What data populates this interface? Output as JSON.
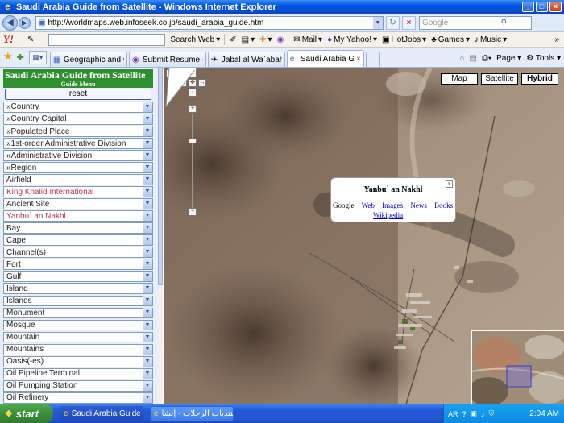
{
  "window": {
    "title": "Saudi Arabia Guide from Satellite - Windows Internet Explorer",
    "minimize": "_",
    "maximize": "□",
    "close": "×"
  },
  "address": {
    "url": "http://worldmaps.web.infoseek.co.jp/saudi_arabia_guide.htm",
    "search_placeholder": "Google"
  },
  "yahoo_toolbar": {
    "logo": "Y!",
    "search_button": "Search Web",
    "mail": "Mail",
    "my_yahoo": "My Yahoo!",
    "hotjobs": "HotJobs",
    "games": "Games",
    "music": "Music"
  },
  "tabs": [
    {
      "label": "Geographic and Geosp..."
    },
    {
      "label": "Submit Resume - Get N..."
    },
    {
      "label": "Jabal al Wa`abah, Sau..."
    },
    {
      "label": "Saudi Arabia Guide ..."
    }
  ],
  "tab_tools": {
    "page": "Page",
    "tools": "Tools"
  },
  "sidebar": {
    "title": "Saudi Arabia Guide from Satellite",
    "subtitle": "Guide Menu",
    "reset": "reset",
    "selects": [
      {
        "label": "»Country",
        "highlight": false
      },
      {
        "label": "»Country Capital",
        "highlight": false
      },
      {
        "label": "»Populated Place",
        "highlight": false
      },
      {
        "label": "»1st-order Administrative Division",
        "highlight": false
      },
      {
        "label": "»Administrative Division",
        "highlight": false
      },
      {
        "label": "»Region",
        "highlight": false
      },
      {
        "label": "Airfield",
        "highlight": false
      },
      {
        "label": "King Khalid International",
        "highlight": true
      },
      {
        "label": "Ancient Site",
        "highlight": false
      },
      {
        "label": "Yanbu` an Nakhl",
        "highlight": true
      },
      {
        "label": "Bay",
        "highlight": false
      },
      {
        "label": "Cape",
        "highlight": false
      },
      {
        "label": "Channel(s)",
        "highlight": false
      },
      {
        "label": "Fort",
        "highlight": false
      },
      {
        "label": "Gulf",
        "highlight": false
      },
      {
        "label": "Island",
        "highlight": false
      },
      {
        "label": "Islands",
        "highlight": false
      },
      {
        "label": "Monument",
        "highlight": false
      },
      {
        "label": "Mosque",
        "highlight": false
      },
      {
        "label": "Mountain",
        "highlight": false
      },
      {
        "label": "Mountains",
        "highlight": false
      },
      {
        "label": "Oasis(-es)",
        "highlight": false
      },
      {
        "label": "Oil Pipeline Terminal",
        "highlight": false
      },
      {
        "label": "Oil Pumping Station",
        "highlight": false
      },
      {
        "label": "Oil Refinery",
        "highlight": false
      }
    ]
  },
  "map": {
    "types": [
      "Map",
      "Satellite",
      "Hybrid"
    ],
    "active_type": "Hybrid",
    "pan_labels": {
      "east_west": "E",
      "up": "↑",
      "left": "←",
      "center": "✥",
      "right": "→",
      "down": "↓",
      "zoom_in": "+",
      "zoom_out": "−"
    },
    "infowindow": {
      "title": "Yanbu` an Nakhl",
      "google": "Google",
      "links": [
        "Web",
        "Images",
        "News",
        "Books"
      ],
      "wiki": "Wikipedia",
      "close": "x"
    }
  },
  "taskbar": {
    "start": "start",
    "tasks": [
      {
        "label": "Saudi Arabia Guide fr..."
      },
      {
        "label": "منتديات الرحلات - إنشا..."
      }
    ],
    "lang": "AR",
    "clock": "2:04 AM"
  },
  "colors": {
    "guide_green": "#2f8f2f",
    "highlight_text": "#b83a52",
    "link_blue": "#0000cc"
  }
}
